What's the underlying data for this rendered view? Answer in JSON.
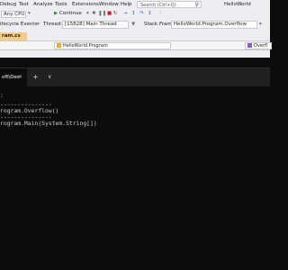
{
  "menu": {
    "items": [
      "Debug",
      "Test",
      "Analyze",
      "Tools",
      "Extensions",
      "Window",
      "Help"
    ],
    "search_placeholder": "Search (Ctrl+Q)",
    "solution_name": "HelloWorld"
  },
  "toolbar": {
    "config": "Any CPU",
    "continue_label": "Continue",
    "continue_arrow": "▶",
    "dropdown": "▾"
  },
  "debug_bar": {
    "lifecycle_events": "ifecycle Events",
    "thread_label": "Thread:",
    "thread_value": "[15828] Main Thread",
    "stack_frame_label": "Stack Frame:",
    "stack_frame_value": "HelloWorld.Program.Overflow"
  },
  "editor": {
    "tab": "ram.cs",
    "nav_class": "HelloWorld.Program",
    "nav_member": "Overfl"
  },
  "terminal": {
    "tab_title": "oft\\Des",
    "close_glyph": "×",
    "plus_glyph": "+",
    "dropdown_glyph": "∨",
    "lines": [
      ":",
      "---------------",
      "rogram.Overflow()",
      "---------------",
      "rogram.Main(System.String[])"
    ]
  },
  "colors": {
    "vs_chrome": "#eeeef2",
    "active_tab": "#f5cc84",
    "terminal_bg": "#0c0c0c",
    "terminal_tabbar": "#202020",
    "terminal_text": "#cccccc"
  }
}
